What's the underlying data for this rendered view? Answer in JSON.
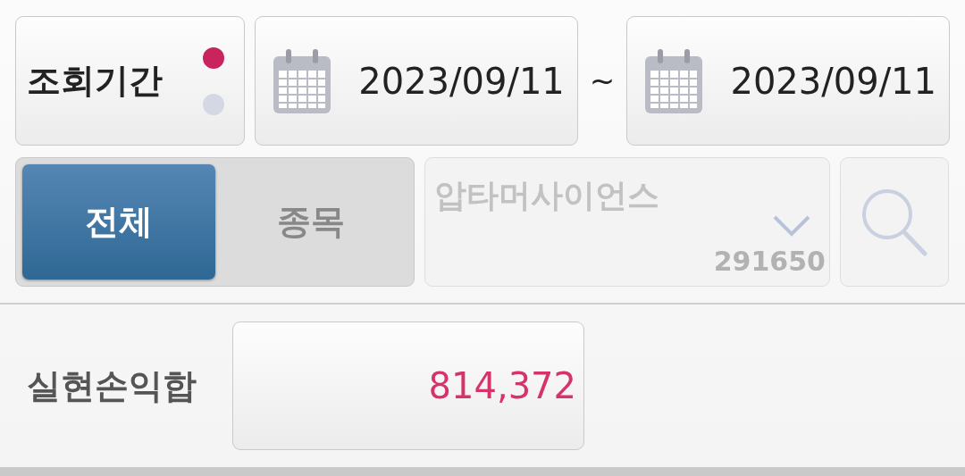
{
  "period": {
    "label": "조회기간",
    "options": [
      {
        "selected": true
      },
      {
        "selected": false
      }
    ]
  },
  "date_range": {
    "start": "2023/09/11",
    "separator": "~",
    "end": "2023/09/11"
  },
  "filter_tabs": [
    {
      "label": "전체",
      "selected": true
    },
    {
      "label": "종목",
      "selected": false
    }
  ],
  "stock_select": {
    "name": "압타머사이언스",
    "code": "291650",
    "disabled": true
  },
  "search_button": {
    "disabled": true
  },
  "summary": {
    "label": "실현손익합",
    "value": "814,372"
  }
}
